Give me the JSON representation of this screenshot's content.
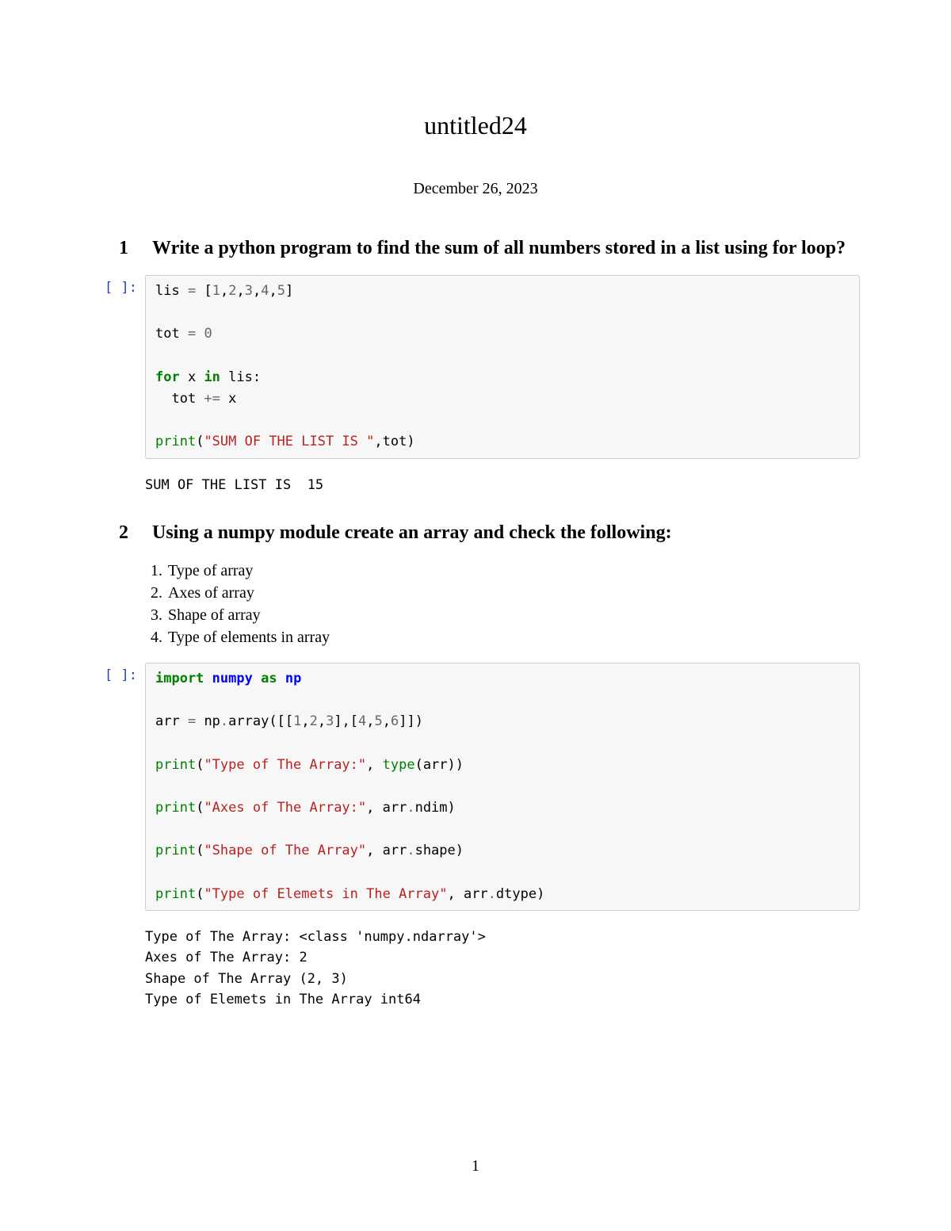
{
  "title": "untitled24",
  "date": "December 26, 2023",
  "section1": {
    "num": "1",
    "heading": "Write a python program to find the sum of all numbers stored in a list using for loop?"
  },
  "cell1": {
    "prompt": "[ ]:",
    "code": {
      "l1a": "lis ",
      "l1b": "=",
      "l1c": " [",
      "l1d": "1",
      "l1e": ",",
      "l1f": "2",
      "l1g": ",",
      "l1h": "3",
      "l1i": ",",
      "l1j": "4",
      "l1k": ",",
      "l1l": "5",
      "l1m": "]",
      "l3a": "tot ",
      "l3b": "=",
      "l3c": " ",
      "l3d": "0",
      "l5a": "for",
      "l5b": " x ",
      "l5c": "in",
      "l5d": " lis:",
      "l6a": "  tot ",
      "l6b": "+=",
      "l6c": " x",
      "l8a": "print",
      "l8b": "(",
      "l8c": "\"SUM OF THE LIST IS \"",
      "l8d": ",tot)"
    },
    "output": "SUM OF THE LIST IS  15"
  },
  "section2": {
    "num": "2",
    "heading": "Using a numpy module create an array and check the following:",
    "items": [
      "Type of array",
      "Axes of array",
      "Shape of array",
      "Type of elements in array"
    ]
  },
  "cell2": {
    "prompt": "[ ]:",
    "code": {
      "l1a": "import",
      "l1b": " ",
      "l1c": "numpy",
      "l1d": " ",
      "l1e": "as",
      "l1f": " ",
      "l1g": "np",
      "l3a": "arr ",
      "l3b": "=",
      "l3c": " np",
      "l3d": ".",
      "l3e": "array([[",
      "l3f": "1",
      "l3g": ",",
      "l3h": "2",
      "l3i": ",",
      "l3j": "3",
      "l3k": "],[",
      "l3l": "4",
      "l3m": ",",
      "l3n": "5",
      "l3o": ",",
      "l3p": "6",
      "l3q": "]])",
      "l5a": "print",
      "l5b": "(",
      "l5c": "\"Type of The Array:\"",
      "l5d": ", ",
      "l5e": "type",
      "l5f": "(arr))",
      "l7a": "print",
      "l7b": "(",
      "l7c": "\"Axes of The Array:\"",
      "l7d": ", arr",
      "l7e": ".",
      "l7f": "ndim)",
      "l9a": "print",
      "l9b": "(",
      "l9c": "\"Shape of The Array\"",
      "l9d": ", arr",
      "l9e": ".",
      "l9f": "shape)",
      "l11a": "print",
      "l11b": "(",
      "l11c": "\"Type of Elemets in The Array\"",
      "l11d": ", arr",
      "l11e": ".",
      "l11f": "dtype)"
    },
    "output": "Type of The Array: <class 'numpy.ndarray'>\nAxes of The Array: 2\nShape of The Array (2, 3)\nType of Elemets in The Array int64"
  },
  "page_number": "1"
}
